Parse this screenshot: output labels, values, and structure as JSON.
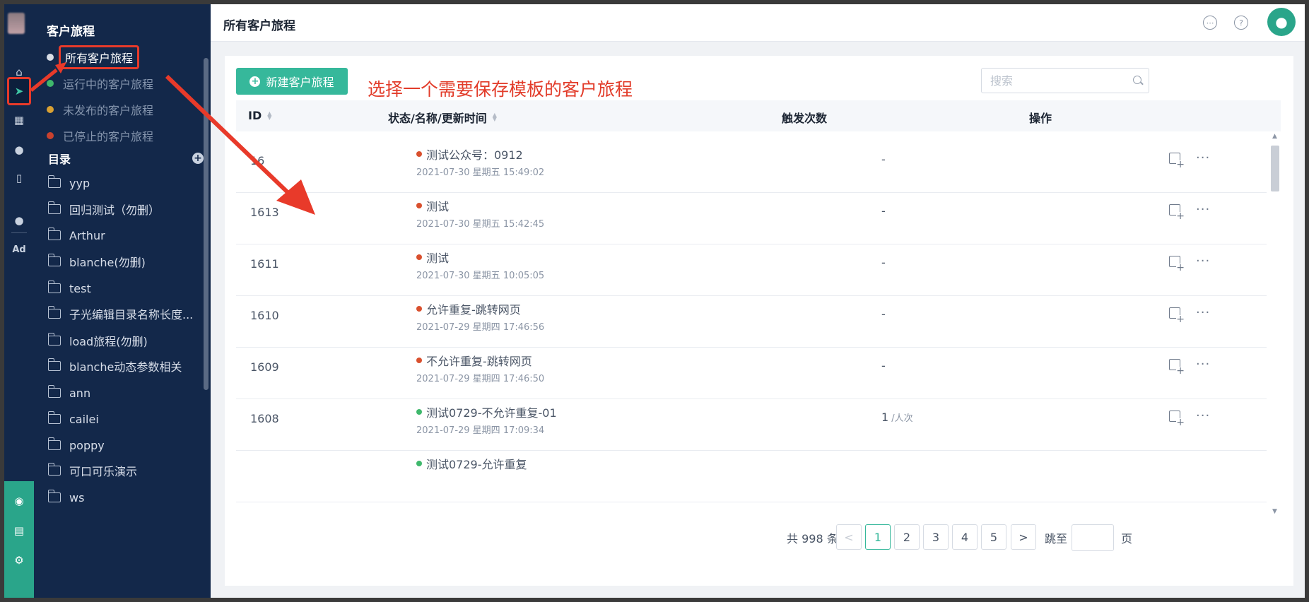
{
  "nav": {
    "title": "客户旅程",
    "status_items": [
      {
        "label": "所有客户旅程",
        "dot_color": "#d8dde6",
        "active": true
      },
      {
        "label": "运行中的客户旅程",
        "dot_color": "#3fb86c",
        "active": false
      },
      {
        "label": "未发布的客户旅程",
        "dot_color": "#d9a133",
        "active": false
      },
      {
        "label": "已停止的客户旅程",
        "dot_color": "#c9412e",
        "active": false
      }
    ],
    "section_label": "目录",
    "folders": [
      "yyp",
      "回归测试（勿删）",
      "Arthur",
      "blanche(勿删)",
      "test",
      "子光编辑目录名称长度...",
      "load旅程(勿删)",
      "blanche动态参数相关",
      "ann",
      "cailei",
      "poppy",
      "可口可乐演示",
      "ws"
    ]
  },
  "header": {
    "title": "所有客户旅程"
  },
  "toolbar": {
    "new_button_label": "新建客户旅程",
    "annotation": "选择一个需要保存模板的客户旅程",
    "search_placeholder": "搜索"
  },
  "table": {
    "columns": {
      "id": "ID",
      "status_name_time": "状态/名称/更新时间",
      "trigger_count": "触发次数",
      "actions": "操作"
    },
    "rows": [
      {
        "id": "16",
        "name": "测试公众号：0912",
        "status_color": "#d9502e",
        "time": "2021-07-30 星期五 15:49:02",
        "trigger": "-",
        "unit": ""
      },
      {
        "id": "1613",
        "name": "测试",
        "status_color": "#d9502e",
        "time": "2021-07-30 星期五 15:42:45",
        "trigger": "-",
        "unit": ""
      },
      {
        "id": "1611",
        "name": "测试",
        "status_color": "#d9502e",
        "time": "2021-07-30 星期五 10:05:05",
        "trigger": "-",
        "unit": ""
      },
      {
        "id": "1610",
        "name": "允许重复-跳转网页",
        "status_color": "#d9502e",
        "time": "2021-07-29 星期四 17:46:56",
        "trigger": "-",
        "unit": ""
      },
      {
        "id": "1609",
        "name": "不允许重复-跳转网页",
        "status_color": "#d9502e",
        "time": "2021-07-29 星期四 17:46:50",
        "trigger": "-",
        "unit": ""
      },
      {
        "id": "1608",
        "name": "测试0729-不允许重复-01",
        "status_color": "#3fb86c",
        "time": "2021-07-29 星期四 17:09:34",
        "trigger": "1",
        "unit": "/人次"
      },
      {
        "id": "",
        "name": "测试0729-允许重复",
        "status_color": "#3fb86c",
        "time": "",
        "trigger": "",
        "unit": ""
      }
    ]
  },
  "pagination": {
    "total_text": "共 998 条",
    "prev": "<",
    "pages": [
      "1",
      "2",
      "3",
      "4",
      "5"
    ],
    "current": "1",
    "next": ">",
    "jump_label": "跳至",
    "page_suffix": "页"
  },
  "icons": {
    "rail": [
      "home-icon",
      "send-icon",
      "layout-icon",
      "user-icon",
      "bar-chart-icon",
      "wechat-icon",
      "ad-icon",
      "radar-icon",
      "server-icon",
      "settings-icon"
    ],
    "header": [
      "chat-icon",
      "help-icon",
      "user-avatar-icon"
    ]
  },
  "colors": {
    "accent": "#36b89b",
    "sidebar": "#13284a",
    "annotation_red": "#e23c2a"
  }
}
